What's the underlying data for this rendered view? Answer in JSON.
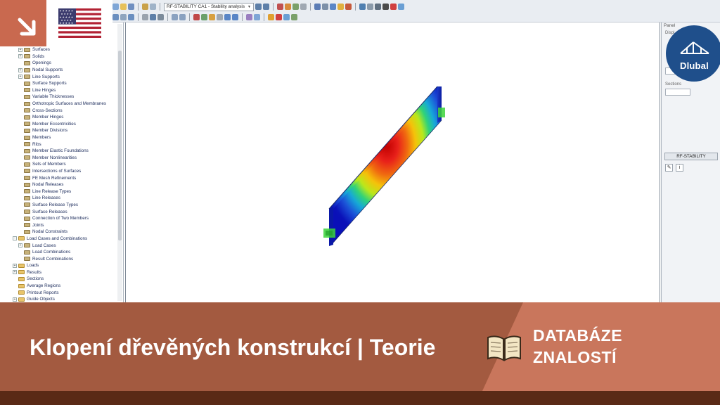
{
  "toolbar": {
    "combo_value": "RF-STABILITY CA1 - Stability analysis"
  },
  "navigator": {
    "items": [
      {
        "label": "Surfaces",
        "type": "item",
        "expander": "+"
      },
      {
        "label": "Solids",
        "type": "item",
        "expander": "+"
      },
      {
        "label": "Openings",
        "type": "item",
        "expander": ""
      },
      {
        "label": "Nodal Supports",
        "type": "item",
        "expander": "+"
      },
      {
        "label": "Line Supports",
        "type": "item",
        "expander": "+"
      },
      {
        "label": "Surface Supports",
        "type": "item",
        "expander": ""
      },
      {
        "label": "Line Hinges",
        "type": "item",
        "expander": ""
      },
      {
        "label": "Variable Thicknesses",
        "type": "item",
        "expander": ""
      },
      {
        "label": "Orthotropic Surfaces and Membranes",
        "type": "item",
        "expander": ""
      },
      {
        "label": "Cross-Sections",
        "type": "item",
        "expander": ""
      },
      {
        "label": "Member Hinges",
        "type": "item",
        "expander": ""
      },
      {
        "label": "Member Eccentricities",
        "type": "item",
        "expander": ""
      },
      {
        "label": "Member Divisions",
        "type": "item",
        "expander": ""
      },
      {
        "label": "Members",
        "type": "item",
        "expander": ""
      },
      {
        "label": "Ribs",
        "type": "item",
        "expander": ""
      },
      {
        "label": "Member Elastic Foundations",
        "type": "item",
        "expander": ""
      },
      {
        "label": "Member Nonlinearities",
        "type": "item",
        "expander": ""
      },
      {
        "label": "Sets of Members",
        "type": "item",
        "expander": ""
      },
      {
        "label": "Intersections of Surfaces",
        "type": "item",
        "expander": ""
      },
      {
        "label": "FE Mesh Refinements",
        "type": "item",
        "expander": ""
      },
      {
        "label": "Nodal Releases",
        "type": "item",
        "expander": ""
      },
      {
        "label": "Line Release Types",
        "type": "item",
        "expander": ""
      },
      {
        "label": "Line Releases",
        "type": "item",
        "expander": ""
      },
      {
        "label": "Surface Release Types",
        "type": "item",
        "expander": ""
      },
      {
        "label": "Surface Releases",
        "type": "item",
        "expander": ""
      },
      {
        "label": "Connection of Two Members",
        "type": "item",
        "expander": ""
      },
      {
        "label": "Joints",
        "type": "item",
        "expander": ""
      },
      {
        "label": "Nodal Constraints",
        "type": "item",
        "expander": ""
      },
      {
        "label": "Load Cases and Combinations",
        "type": "folder",
        "expander": "-"
      },
      {
        "label": "Load Cases",
        "type": "item",
        "expander": "+"
      },
      {
        "label": "Load Combinations",
        "type": "item",
        "expander": ""
      },
      {
        "label": "Result Combinations",
        "type": "item",
        "expander": ""
      },
      {
        "label": "Loads",
        "type": "folder",
        "expander": "+"
      },
      {
        "label": "Results",
        "type": "folder",
        "expander": "+"
      },
      {
        "label": "Sections",
        "type": "folder",
        "expander": ""
      },
      {
        "label": "Average Regions",
        "type": "folder",
        "expander": ""
      },
      {
        "label": "Printout Reports",
        "type": "folder",
        "expander": ""
      },
      {
        "label": "Guide Objects",
        "type": "folder",
        "expander": "+"
      }
    ]
  },
  "panel": {
    "title": "Panel",
    "label1": "Displ",
    "label2": "Sections",
    "button_label": "RF-STABILITY"
  },
  "logo": {
    "text": "Dlubal"
  },
  "banner": {
    "title": "Klopení dřevěných konstrukcí | Teorie",
    "tag_line1": "DATABÁZE",
    "tag_line2": "ZNALOSTÍ"
  },
  "colors": {
    "accent": "#c9694f",
    "banner": "#a35a40",
    "banner_dark": "#5a2a16",
    "logo_blue": "#1f4f8b"
  }
}
